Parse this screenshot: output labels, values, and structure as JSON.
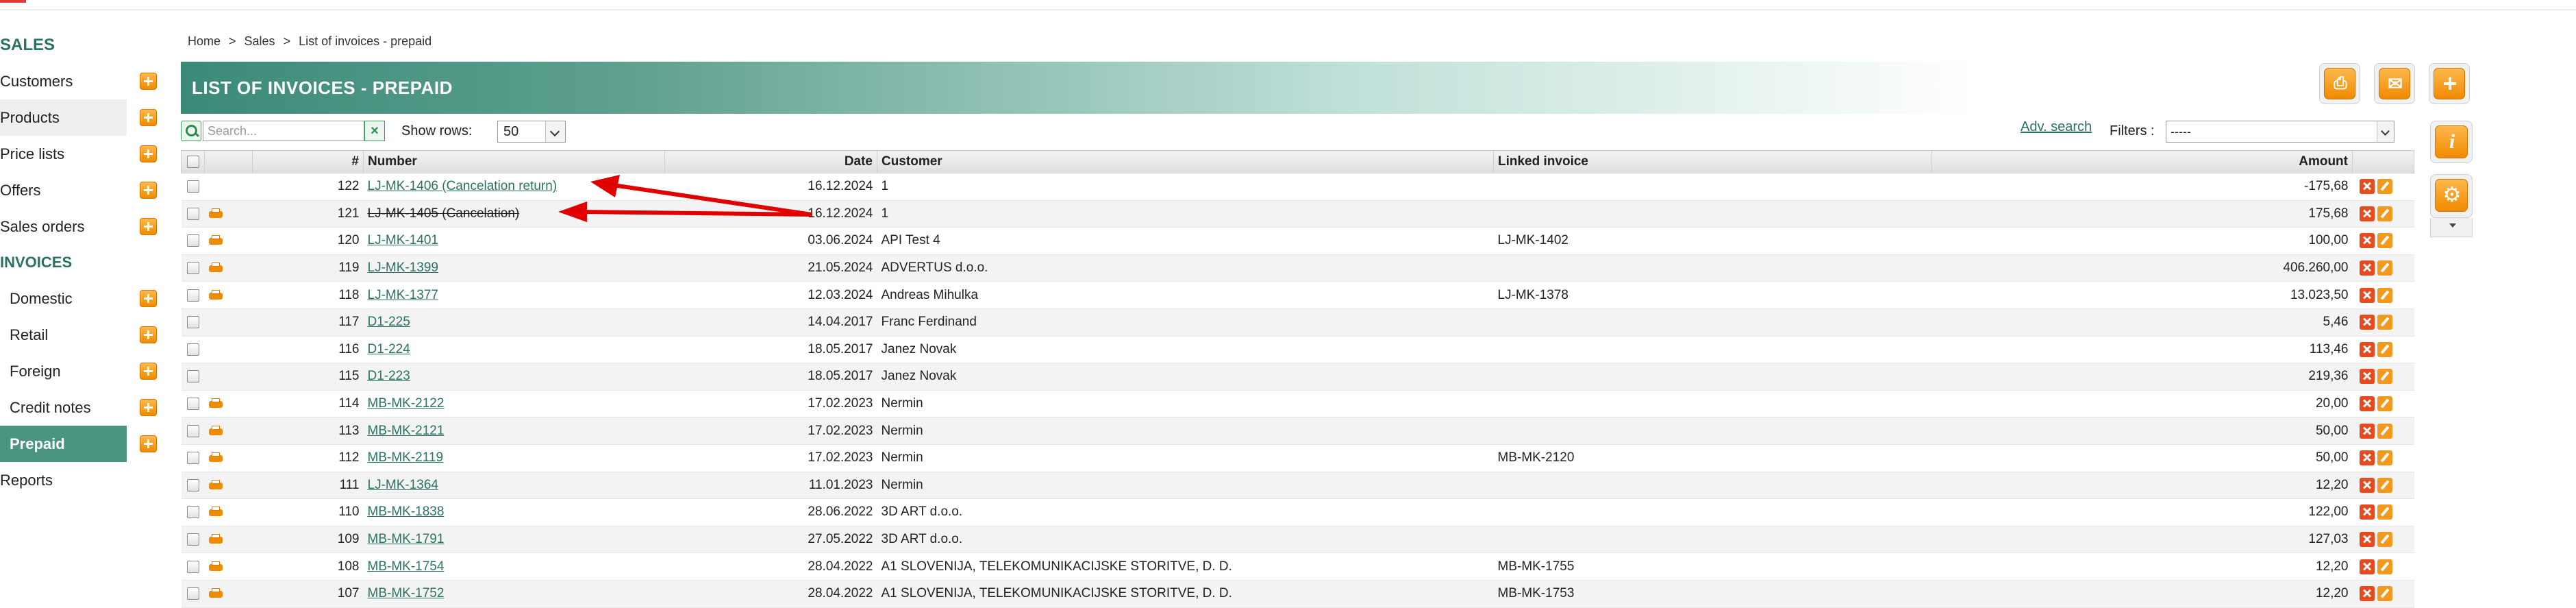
{
  "sidebar": {
    "sales_title": "SALES",
    "sales_items": [
      {
        "label": "Customers"
      },
      {
        "label": "Products"
      },
      {
        "label": "Price lists"
      },
      {
        "label": "Offers"
      },
      {
        "label": "Sales orders"
      }
    ],
    "invoices_title": "INVOICES",
    "invoice_items": [
      {
        "label": "Domestic"
      },
      {
        "label": "Retail"
      },
      {
        "label": "Foreign"
      },
      {
        "label": "Credit notes"
      },
      {
        "label": "Prepaid"
      }
    ],
    "reports_label": "Reports"
  },
  "breadcrumb": {
    "home": "Home",
    "sales": "Sales",
    "current": "List of invoices - prepaid",
    "sep": ">"
  },
  "page_title": "LIST OF INVOICES - PREPAID",
  "filterbar": {
    "search_placeholder": "Search...",
    "show_rows_label": "Show rows:",
    "show_rows_value": "50",
    "adv_search": "Adv. search",
    "filters_label": "Filters :",
    "filters_value": "-----"
  },
  "table": {
    "headers": {
      "num": "#",
      "number": "Number",
      "date": "Date",
      "customer": "Customer",
      "linked": "Linked invoice",
      "amount": "Amount"
    },
    "rows": [
      {
        "num": "122",
        "number": "LJ-MK-1406 (Cancelation return)",
        "date": "16.12.2024",
        "customer": "1",
        "linked": "",
        "amount": "-175,68",
        "print": false,
        "struck": false
      },
      {
        "num": "121",
        "number": "LJ-MK-1405 (Cancelation)",
        "date": "16.12.2024",
        "customer": "1",
        "linked": "",
        "amount": "175,68",
        "print": true,
        "struck": true
      },
      {
        "num": "120",
        "number": "LJ-MK-1401",
        "date": "03.06.2024",
        "customer": "API Test 4",
        "linked": "LJ-MK-1402",
        "amount": "100,00",
        "print": true,
        "struck": false
      },
      {
        "num": "119",
        "number": "LJ-MK-1399",
        "date": "21.05.2024",
        "customer": "ADVERTUS d.o.o.",
        "linked": "",
        "amount": "406.260,00",
        "print": true,
        "struck": false
      },
      {
        "num": "118",
        "number": "LJ-MK-1377",
        "date": "12.03.2024",
        "customer": "Andreas Mihulka",
        "linked": "LJ-MK-1378",
        "amount": "13.023,50",
        "print": true,
        "struck": false
      },
      {
        "num": "117",
        "number": "D1-225",
        "date": "14.04.2017",
        "customer": "Franc Ferdinand",
        "linked": "",
        "amount": "5,46",
        "print": false,
        "struck": false
      },
      {
        "num": "116",
        "number": "D1-224",
        "date": "18.05.2017",
        "customer": "Janez Novak",
        "linked": "",
        "amount": "113,46",
        "print": false,
        "struck": false
      },
      {
        "num": "115",
        "number": "D1-223",
        "date": "18.05.2017",
        "customer": "Janez Novak",
        "linked": "",
        "amount": "219,36",
        "print": false,
        "struck": false
      },
      {
        "num": "114",
        "number": "MB-MK-2122",
        "date": "17.02.2023",
        "customer": "Nermin",
        "linked": "",
        "amount": "20,00",
        "print": true,
        "struck": false
      },
      {
        "num": "113",
        "number": "MB-MK-2121",
        "date": "17.02.2023",
        "customer": "Nermin",
        "linked": "",
        "amount": "50,00",
        "print": true,
        "struck": false
      },
      {
        "num": "112",
        "number": "MB-MK-2119",
        "date": "17.02.2023",
        "customer": "Nermin",
        "linked": "MB-MK-2120",
        "amount": "50,00",
        "print": true,
        "struck": false
      },
      {
        "num": "111",
        "number": "LJ-MK-1364",
        "date": "11.01.2023",
        "customer": "Nermin",
        "linked": "",
        "amount": "12,20",
        "print": true,
        "struck": false
      },
      {
        "num": "110",
        "number": "MB-MK-1838",
        "date": "28.06.2022",
        "customer": "3D ART d.o.o.",
        "linked": "",
        "amount": "122,00",
        "print": true,
        "struck": false
      },
      {
        "num": "109",
        "number": "MB-MK-1791",
        "date": "27.05.2022",
        "customer": "3D ART d.o.o.",
        "linked": "",
        "amount": "127,03",
        "print": true,
        "struck": false
      },
      {
        "num": "108",
        "number": "MB-MK-1754",
        "date": "28.04.2022",
        "customer": "A1 SLOVENIJA, TELEKOMUNIKACIJSKE STORITVE, D. D.",
        "linked": "MB-MK-1755",
        "amount": "12,20",
        "print": true,
        "struck": false
      },
      {
        "num": "107",
        "number": "MB-MK-1752",
        "date": "28.04.2022",
        "customer": "A1 SLOVENIJA, TELEKOMUNIKACIJSKE STORITVE, D. D.",
        "linked": "MB-MK-1753",
        "amount": "12,20",
        "print": true,
        "struck": false
      }
    ]
  },
  "icons": {
    "toolbar": [
      "printer-icon",
      "mail-icon",
      "plus-icon"
    ],
    "side": [
      "info-icon",
      "gear-icon"
    ],
    "row_actions": [
      "delete-icon",
      "edit-icon"
    ]
  },
  "colors": {
    "brand": "#4a9482",
    "accent": "#f08a00",
    "annotation": "#e00000"
  }
}
